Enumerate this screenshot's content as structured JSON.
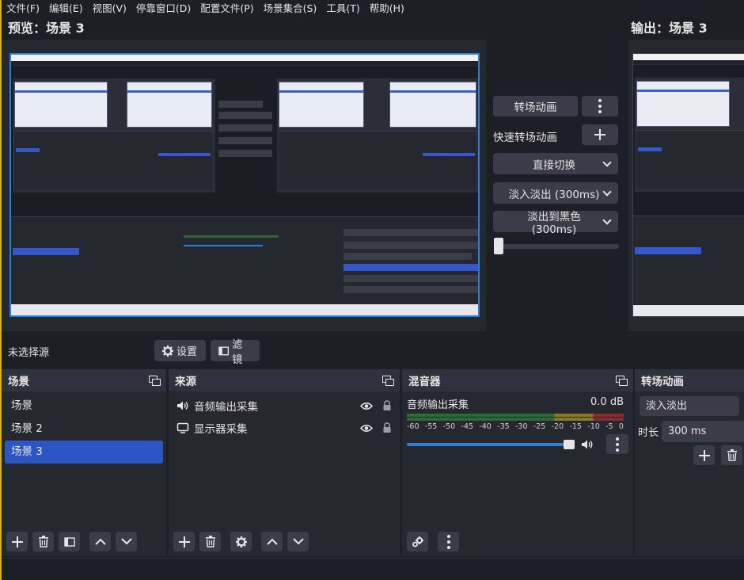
{
  "menu": [
    "文件(F)",
    "编辑(E)",
    "视图(V)",
    "停靠窗口(D)",
    "配置文件(P)",
    "场景集合(S)",
    "工具(T)",
    "帮助(H)"
  ],
  "preview_label": "预览：场景 3",
  "program_label": "输出：场景 3",
  "transition_controls": {
    "transition_button": "转场动画",
    "quick_label": "快速转场动画",
    "quick_items": [
      "直接切换",
      "淡入淡出 (300ms)",
      "淡出到黑色 (300ms)"
    ]
  },
  "context": {
    "no_source": "未选择源",
    "settings": "设置",
    "filters": "滤镜"
  },
  "scenes": {
    "title": "场景",
    "items": [
      "场景",
      "场景 2",
      "场景 3"
    ],
    "active_index": 2
  },
  "sources": {
    "title": "来源",
    "items": [
      {
        "name": "音频输出采集",
        "icon": "speaker-icon"
      },
      {
        "name": "显示器采集",
        "icon": "monitor-icon"
      }
    ]
  },
  "mixer": {
    "title": "混音器",
    "channel": "音频输出采集",
    "level": "0.0 dB",
    "scale": [
      "-60",
      "-55",
      "-50",
      "-45",
      "-40",
      "-35",
      "-30",
      "-25",
      "-20",
      "-15",
      "-10",
      "-5",
      "0"
    ]
  },
  "transitions": {
    "title": "转场动画",
    "selected": "淡入淡出",
    "duration_label": "时长",
    "duration_value": "300 ms"
  }
}
